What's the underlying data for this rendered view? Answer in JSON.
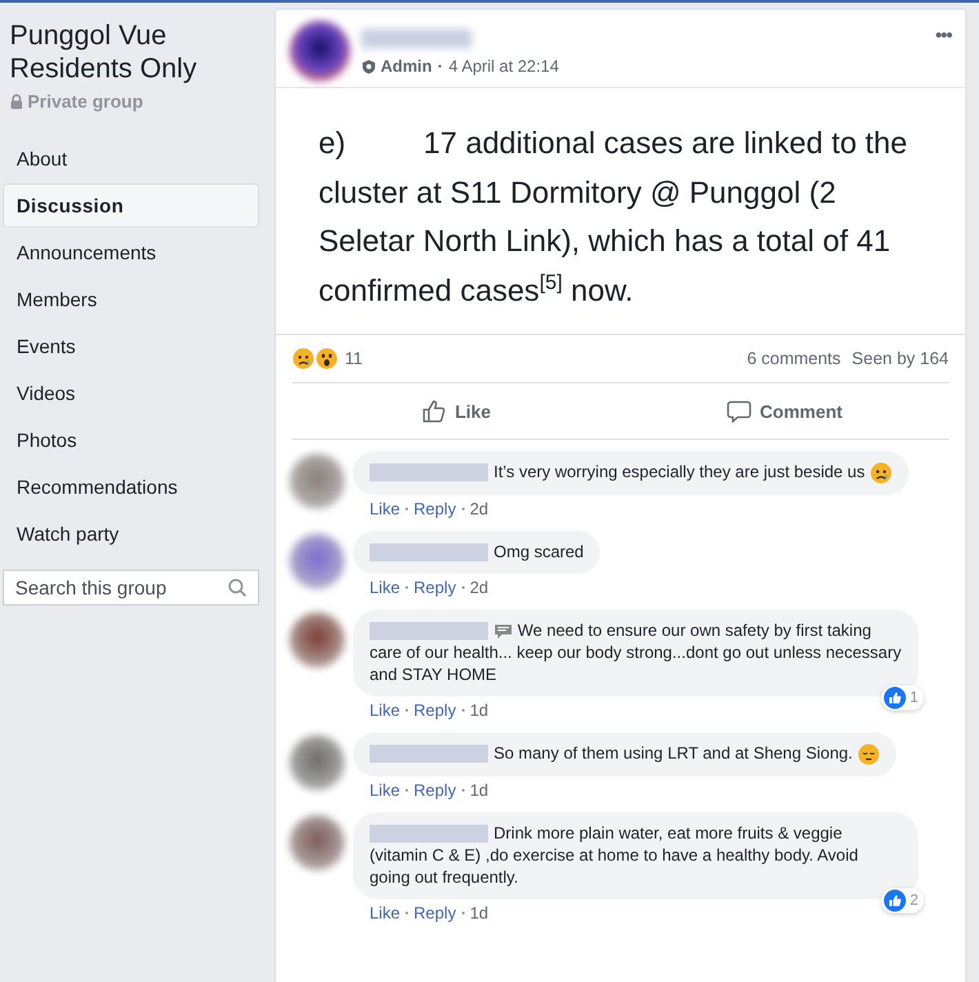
{
  "sidebar": {
    "group_name": "Punggol Vue Residents Only",
    "privacy": "Private group",
    "items": [
      {
        "label": "About",
        "selected": false
      },
      {
        "label": "Discussion",
        "selected": true
      },
      {
        "label": "Announcements",
        "selected": false
      },
      {
        "label": "Members",
        "selected": false
      },
      {
        "label": "Events",
        "selected": false
      },
      {
        "label": "Videos",
        "selected": false
      },
      {
        "label": "Photos",
        "selected": false
      },
      {
        "label": "Recommendations",
        "selected": false
      },
      {
        "label": "Watch party",
        "selected": false
      }
    ],
    "search": {
      "placeholder": "Search this group"
    }
  },
  "post": {
    "role": "Admin",
    "time": "4 April at 22:14",
    "menu": "•••",
    "list_marker": "e)",
    "text": "17 additional cases are linked to the cluster at S11 Dormitory @ Punggol (2 Seletar North Link), which has a total of 41 confirmed cases$^{[5]}$ now.",
    "reactions": [
      {
        "kind": "sad"
      },
      {
        "kind": "wow"
      }
    ],
    "reaction_count": "11",
    "comments_count": "6 comments",
    "seen_by": "Seen by 164",
    "actions": [
      {
        "kind": "like",
        "label": "Like"
      },
      {
        "kind": "comment",
        "label": "Comment"
      }
    ]
  },
  "comments": [
    {
      "text": "It’s very worrying especially they are just beside us",
      "trailing_emoji": {
        "kind": "sad"
      },
      "actions": [
        "Like",
        "Reply",
        "2d"
      ]
    },
    {
      "text": "Omg scared",
      "actions": [
        "Like",
        "Reply",
        "2d"
      ]
    },
    {
      "text": "We need to ensure our own safety by first taking care of our health... keep our body strong...dont go out unless necessary and STAY HOME",
      "leading_emoji": {
        "kind": "speech"
      },
      "likes": "1",
      "actions": [
        "Like",
        "Reply",
        "1d"
      ]
    },
    {
      "text": "So many of them using LRT and at Sheng Siong.",
      "trailing_emoji": {
        "kind": "pensive"
      },
      "actions": [
        "Like",
        "Reply",
        "1d"
      ]
    },
    {
      "text": "Drink more plain water, eat more fruits & veggie (vitamin C & E) ,do exercise at home to have a healthy body. Avoid going out frequently.",
      "likes": "2",
      "actions": [
        "Like",
        "Reply",
        "1d"
      ]
    }
  ]
}
